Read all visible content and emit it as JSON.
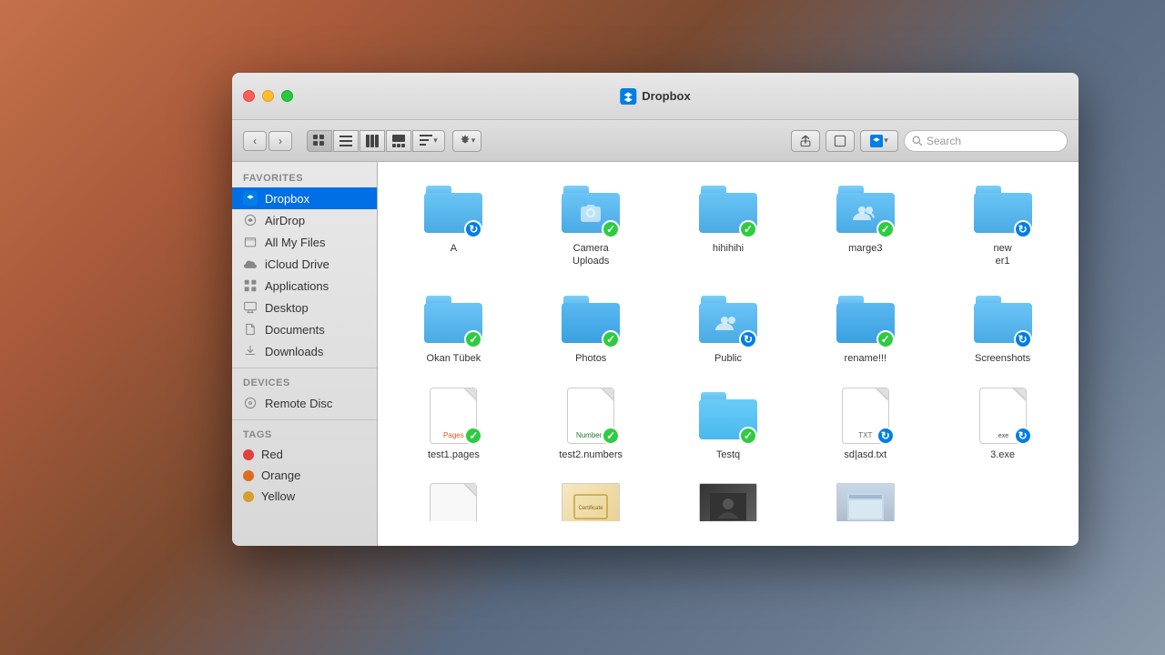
{
  "window": {
    "title": "Dropbox",
    "traffic_lights": {
      "close": "close",
      "minimize": "minimize",
      "maximize": "maximize"
    }
  },
  "toolbar": {
    "back_label": "‹",
    "forward_label": "›",
    "view_icon_label": "⊞",
    "view_list_label": "≡",
    "view_col_label": "⊟",
    "view_cov_label": "⊠",
    "view_grid_label": "⊞",
    "arrange_label": "⚙",
    "share_label": "↑",
    "tag_label": "⬜",
    "action_label": "⚙",
    "search_placeholder": "Search"
  },
  "sidebar": {
    "favorites_label": "FAVORITES",
    "devices_label": "DEVICES",
    "tags_label": "TAGS",
    "items": [
      {
        "id": "dropbox",
        "label": "Dropbox",
        "icon": "dropbox",
        "active": true
      },
      {
        "id": "airdrop",
        "label": "AirDrop",
        "icon": "airdrop",
        "active": false
      },
      {
        "id": "all-my-files",
        "label": "All My Files",
        "icon": "files",
        "active": false
      },
      {
        "id": "icloud-drive",
        "label": "iCloud Drive",
        "icon": "icloud",
        "active": false
      },
      {
        "id": "applications",
        "label": "Applications",
        "icon": "apps",
        "active": false
      },
      {
        "id": "desktop",
        "label": "Desktop",
        "icon": "desktop",
        "active": false
      },
      {
        "id": "documents",
        "label": "Documents",
        "icon": "docs",
        "active": false
      },
      {
        "id": "downloads",
        "label": "Downloads",
        "icon": "downloads",
        "active": false
      }
    ],
    "devices": [
      {
        "id": "remote-disc",
        "label": "Remote Disc",
        "icon": "disc"
      }
    ],
    "tags": [
      {
        "id": "red",
        "label": "Red",
        "color": "#e53e3e"
      },
      {
        "id": "orange",
        "label": "Orange",
        "color": "#dd6b20"
      },
      {
        "id": "yellow",
        "label": "Yellow",
        "color": "#d69e2e"
      }
    ]
  },
  "files": [
    {
      "id": "a",
      "name": "A",
      "type": "folder",
      "badge": "blue-sync"
    },
    {
      "id": "camera-uploads",
      "name": "Camera Uploads",
      "type": "folder",
      "badge": "green"
    },
    {
      "id": "hihihihi",
      "name": "hihihihi",
      "type": "folder",
      "badge": "green"
    },
    {
      "id": "marge3",
      "name": "marge3",
      "type": "folder-people",
      "badge": "green"
    },
    {
      "id": "newer1",
      "name": "new\ner1",
      "type": "folder",
      "badge": "blue-sync"
    },
    {
      "id": "okan-tubek",
      "name": "Okan Tübek",
      "type": "folder",
      "badge": "green"
    },
    {
      "id": "photos",
      "name": "Photos",
      "type": "folder",
      "badge": "green"
    },
    {
      "id": "public",
      "name": "Public",
      "type": "folder-people",
      "badge": "blue-sync"
    },
    {
      "id": "rename",
      "name": "rename!!!",
      "type": "folder",
      "badge": "green"
    },
    {
      "id": "screenshots",
      "name": "Screenshots",
      "type": "folder",
      "badge": "blue-sync"
    },
    {
      "id": "test1-pages",
      "name": "test1.pages",
      "type": "pages",
      "badge": "green"
    },
    {
      "id": "test2-numbers",
      "name": "test2.numbers",
      "type": "numbers",
      "badge": "green"
    },
    {
      "id": "testq",
      "name": "Testq",
      "type": "folder",
      "badge": "green"
    },
    {
      "id": "sdlasd-txt",
      "name": "sd|asd.txt",
      "type": "txt",
      "badge": "blue-sync"
    },
    {
      "id": "3-exe",
      "name": "3.exe",
      "type": "exe",
      "badge": "blue-sync"
    },
    {
      "id": "scroll1",
      "name": "",
      "type": "scroll-doc",
      "badge": ""
    },
    {
      "id": "scroll2",
      "name": "",
      "type": "cert",
      "badge": ""
    },
    {
      "id": "scroll3",
      "name": "",
      "type": "photo",
      "badge": ""
    },
    {
      "id": "scroll4",
      "name": "",
      "type": "ui",
      "badge": ""
    }
  ]
}
